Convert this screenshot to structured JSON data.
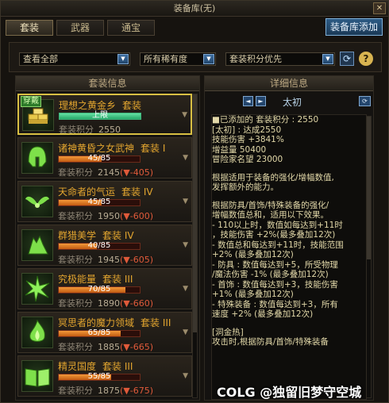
{
  "window": {
    "title": "装备库(无)",
    "close_label": "✕"
  },
  "tabs": [
    {
      "label": "套装",
      "active": true
    },
    {
      "label": "武器"
    },
    {
      "label": "通宝"
    }
  ],
  "add_button": "装备库添加",
  "filters": {
    "view": "查看全部",
    "rarity": "所有稀有度",
    "sort": "套装积分优先"
  },
  "left_panel": {
    "header": "套装信息",
    "items": [
      {
        "name": "理想之黄金乡",
        "tier": "套装",
        "bar_text": "上限",
        "progress": 1.0,
        "score_label": "套装积分",
        "score": "2550",
        "diff": "",
        "badge": "穿戴",
        "icon": "gold-bars-icon"
      },
      {
        "name": "诸神黄昏之女武神",
        "tier": "套装 I",
        "bar_text": "45/85",
        "progress": 0.529,
        "score_label": "套装积分",
        "score": "2145",
        "diff": "(▼-405)",
        "icon": "helmet-icon"
      },
      {
        "name": "天命者的气运",
        "tier": "套装 IV",
        "bar_text": "45/85",
        "progress": 0.529,
        "score_label": "套装积分",
        "score": "1950",
        "diff": "(▼-600)",
        "icon": "wings-icon"
      },
      {
        "name": "群猎美学",
        "tier": "套装 IV",
        "bar_text": "40/85",
        "progress": 0.47,
        "score_label": "套装积分",
        "score": "1945",
        "diff": "(▼-605)",
        "icon": "wolf-icon"
      },
      {
        "name": "究极能量",
        "tier": "套装 III",
        "bar_text": "70/85",
        "progress": 0.82,
        "score_label": "套装积分",
        "score": "1890",
        "diff": "(▼-660)",
        "icon": "burst-icon"
      },
      {
        "name": "冥思者的魔力领域",
        "tier": "套装 III",
        "bar_text": "65/85",
        "progress": 0.76,
        "score_label": "套装积分",
        "score": "1885",
        "diff": "(▼-665)",
        "icon": "flame-icon"
      },
      {
        "name": "精灵国度",
        "tier": "套装 III",
        "bar_text": "55/85",
        "progress": 0.65,
        "score_label": "套装积分",
        "score": "1875",
        "diff": "(▼-675)",
        "icon": "book-icon"
      }
    ]
  },
  "right_panel": {
    "header": "详细信息",
    "nav_title": "太初",
    "lines": [
      "■已添加的 套装积分 : 2550",
      "[太初] : 达成2550",
      "技能伤害 +3841%",
      "增益量 50400",
      "冒险家名望 23000",
      "",
      "根据适用于装备的强化/增幅数值,",
      "发挥额外的能力。",
      "",
      "根据防具/首饰/特殊装备的强化/",
      "增幅数值总和，适用以下效果。",
      "- 110以上时，数值如每达到+11时",
      "，技能伤害 +2%(最多叠加12次)",
      "- 数值总和每达到+11时，技能范围",
      "+2% (最多叠加12次)",
      "- 防具 : 数值每达到+5，所受物理",
      "/魔法伤害 -1% (最多叠加12次)",
      "- 首饰 : 数值每达到+3，技能伤害",
      "+1% (最多叠加12次)",
      "- 特殊装备 : 数值每达到+3，所有",
      "速度 +2% (最多叠加12次)",
      "",
      "[洞金热]",
      "攻击时,根据防具/首饰/特殊装备"
    ]
  },
  "watermark": "COLG @独留旧梦守空城"
}
